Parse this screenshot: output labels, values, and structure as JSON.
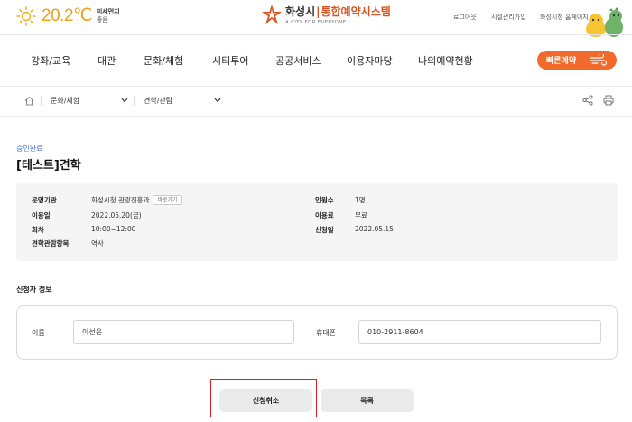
{
  "header": {
    "temperature": "20.2℃",
    "dust_label": "미세먼지",
    "dust_value": "좋음",
    "logo_main_a": "화성시",
    "logo_sep": "|",
    "logo_main_b": "통합예약시스템",
    "logo_sub": "A CITY FOR EVERYONE",
    "links": [
      "로그아웃",
      "시설관리가입",
      "화성시청 홈페이지"
    ]
  },
  "nav": {
    "items": [
      "강좌/교육",
      "대관",
      "문화/체험",
      "시티투어",
      "공공서비스",
      "이용자마당",
      "나의예약현황"
    ],
    "quick_reserve": "빠른예약"
  },
  "breadcrumb": {
    "level1": "문화/체험",
    "level2": "견학/관람"
  },
  "page": {
    "status": "승인완료",
    "title": "[테스트]견학"
  },
  "details": {
    "organizer_label": "운영기관",
    "organizer_value": "화성시청 관광진흥과",
    "organizer_tag": "바로가기",
    "date_label": "이용일",
    "date_value": "2022.05.20(금)",
    "session_label": "회차",
    "session_value": "10:00~12:00",
    "item_label": "견학관람항목",
    "item_value": "역사",
    "people_label": "인원수",
    "people_value": "1명",
    "fee_label": "이용료",
    "fee_value": "무료",
    "apply_label": "신청일",
    "apply_value": "2022.05.15"
  },
  "applicant": {
    "section_title": "신청자 정보",
    "name_label": "이름",
    "name_value": "이선은",
    "phone_label": "휴대폰",
    "phone_value": "010-2911-8604"
  },
  "actions": {
    "cancel": "신청취소",
    "list": "목록"
  },
  "colors": {
    "accent": "#f26a2b",
    "status": "#4a7bd0",
    "highlight": "#e02020",
    "temperature": "#e8a317"
  }
}
